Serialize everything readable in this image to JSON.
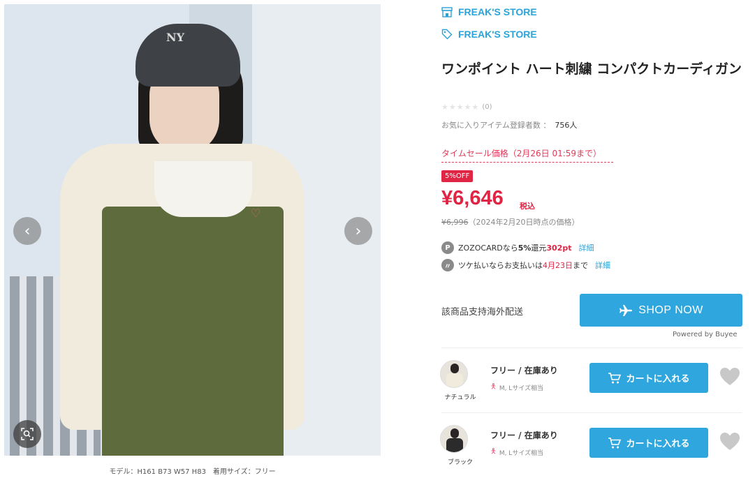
{
  "image": {
    "hat_logo": "NY",
    "caption": "モデル：H161 B73 W57 H83　着用サイズ：フリー"
  },
  "shops": [
    {
      "name": "FREAK'S STORE",
      "icon": "shop-icon"
    },
    {
      "name": "FREAK'S STORE",
      "icon": "tag-icon"
    }
  ],
  "product": {
    "title": "ワンポイント ハート刺繍 コンパクトカーディガン",
    "stars": "★★★★★",
    "review_count": "(0)",
    "favorites_label": "お気に入りアイテム登録者数 ：",
    "favorites_count": "756人",
    "sale_label": "タイムセール価格（2月26日 01:59まで）",
    "off_badge": "5%OFF",
    "price": "¥6,646",
    "tax_label": "税込",
    "old_price": "¥6,996",
    "old_price_note": "（2024年2月20日時点の価格）"
  },
  "points": {
    "zozo_icon": "P",
    "zozo_prefix": "ZOZOCARDなら",
    "zozo_rate": "5%",
    "zozo_mid": "還元",
    "zozo_pt": "302pt",
    "zozo_link": "詳細",
    "tsuke_prefix": "ツケ払いならお支払いは",
    "tsuke_date": "4月23日",
    "tsuke_suffix": "まで",
    "tsuke_link": "詳細"
  },
  "international": {
    "label": "該商品支持海外配送",
    "button": "SHOP NOW",
    "powered": "Powered by Buyee"
  },
  "variants": [
    {
      "color": "ナチュラル",
      "stock": "フリー / 在庫あり",
      "size": "M, Lサイズ相当",
      "cart": "カートに入れる",
      "body_color": "#f1ebdd"
    },
    {
      "color": "ブラック",
      "stock": "フリー / 在庫あり",
      "size": "M, Lサイズ相当",
      "cart": "カートに入れる",
      "body_color": "#2b2b2b"
    }
  ],
  "colors": {
    "accent": "#2fa6de",
    "sale": "#e02444"
  }
}
